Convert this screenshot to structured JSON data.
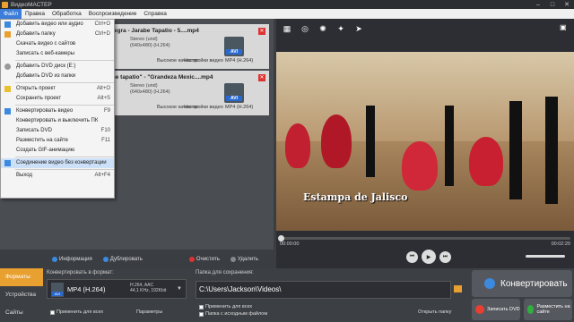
{
  "window": {
    "title": "ВидеоМАСТЕР",
    "controls": [
      "–",
      "□",
      "✕"
    ]
  },
  "menu": [
    "Файл",
    "Правка",
    "Обработка",
    "Воспроизведение",
    "Справка"
  ],
  "file_menu": [
    {
      "label": "Добавить видео или аудио",
      "shortcut": "Ctrl+O",
      "icon": "add-video-icon"
    },
    {
      "label": "Добавить папку",
      "shortcut": "Ctrl+D",
      "icon": "folder-icon"
    },
    {
      "label": "Скачать видео с сайтов",
      "shortcut": "",
      "icon": ""
    },
    {
      "label": "Записать с веб-камеры",
      "shortcut": "",
      "icon": ""
    },
    {
      "label": "Добавить DVD диск (E:)",
      "shortcut": "",
      "icon": "dvd-icon"
    },
    {
      "label": "Добавить DVD из папки",
      "shortcut": "",
      "icon": ""
    },
    {
      "label": "Открыть проект",
      "shortcut": "Alt+O",
      "icon": "open-project-icon"
    },
    {
      "label": "Сохранить проект",
      "shortcut": "Alt+S",
      "icon": ""
    },
    {
      "label": "Конвертировать видео",
      "shortcut": "F9",
      "icon": "convert-icon"
    },
    {
      "label": "Конвертировать и выключить ПК",
      "shortcut": "",
      "icon": ""
    },
    {
      "label": "Записать DVD",
      "shortcut": "F10",
      "icon": ""
    },
    {
      "label": "Разместить на сайте",
      "shortcut": "F11",
      "icon": ""
    },
    {
      "label": "Создать GIF-анимацию",
      "shortcut": "",
      "icon": ""
    },
    {
      "label": "Соединение видео без конвертации",
      "shortcut": "",
      "icon": "join-icon"
    },
    {
      "label": "Выход",
      "shortcut": "Alt+F4",
      "icon": ""
    }
  ],
  "clips": [
    {
      "title": "la Negra - Jarabe Tapatio - 5....mp4",
      "audio": "Stereo (und)",
      "video": "(640x480) (H.264)",
      "quality": "Высокое качество",
      "settings": "Настройки видео",
      "format": "MP4 (H.264)",
      "badge": "AVI"
    },
    {
      "title": "arabe tapatio\" - \"Grandeza Mexic....mp4",
      "audio": "Stereo (und)",
      "video": "(640x480) (H.264)",
      "quality": "Высокое качество",
      "settings": "Настройки видео",
      "format": "MP4 (H.264)",
      "badge": "AVI"
    }
  ],
  "list_toolbar": {
    "info": "Информация",
    "duplicate": "Дублировать",
    "clear": "Очистить",
    "delete": "Удалить"
  },
  "player": {
    "caption": "Estampa de Jalisco",
    "time_start": "00:00:00",
    "time_end": "00:02:20",
    "progress": 0.0
  },
  "tabs": {
    "formats": "Форматы",
    "devices": "Устройства",
    "sites": "Сайты"
  },
  "convert": {
    "label": "Конвертировать в формат:",
    "format": "MP4 (H.264)",
    "badge": "AVI",
    "spec1": "H.264, AAC",
    "spec2": "44,1 KHz, 192Kbit",
    "apply_all": "Применить для всех",
    "params": "Параметры"
  },
  "save": {
    "label": "Папка для сохранения:",
    "path": "C:\\Users\\Jackson\\Videos\\",
    "apply_all": "Применить для всех",
    "source_folder": "Папка с исходным файлом",
    "open_folder": "Открыть папку"
  },
  "actions": {
    "convert": "Конвертировать",
    "dvd": "Записать DVD",
    "site": "Разместить на сайте"
  },
  "colors": {
    "accent": "#e8a030",
    "menu_highlight": "#3b7dd8"
  }
}
